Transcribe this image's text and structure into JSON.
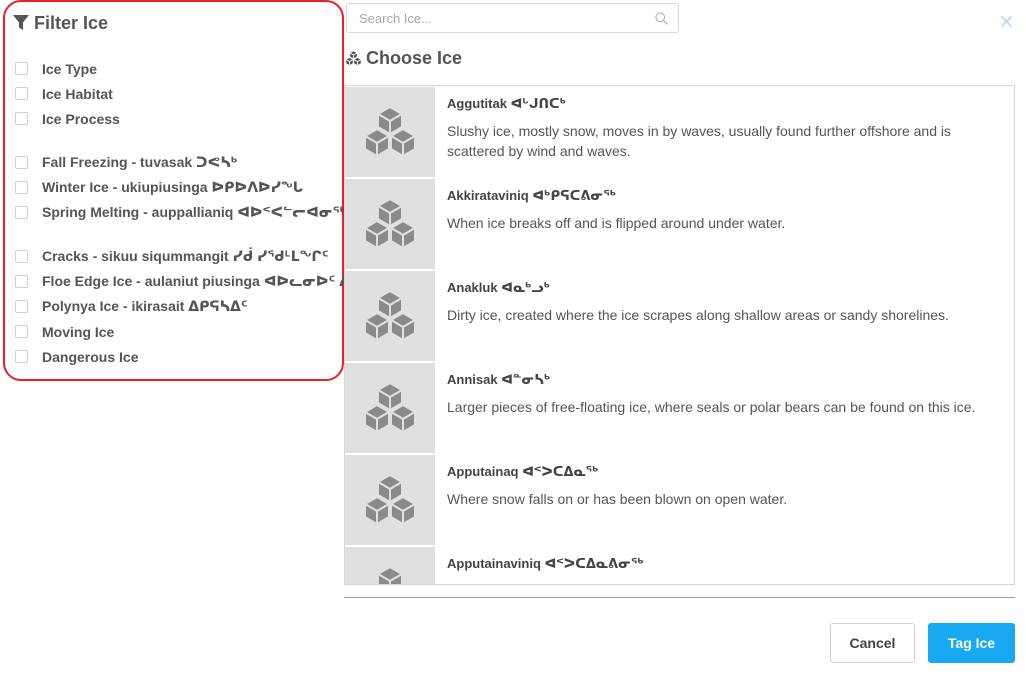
{
  "filter": {
    "title": "Filter Ice",
    "groups": [
      {
        "items": [
          {
            "label": "Ice Type",
            "checked": false
          },
          {
            "label": "Ice Habitat",
            "checked": false
          },
          {
            "label": "Ice Process",
            "checked": false
          }
        ]
      },
      {
        "items": [
          {
            "label": "Fall Freezing - tuvasak ᑐᕙᓴᒃ",
            "checked": false
          },
          {
            "label": "Winter Ice - ukiupiusinga ᐅᑭᐅᐱᐅᓯᖓ",
            "checked": false
          },
          {
            "label": "Spring Melting - auppallianiq ᐊᐅᑉᐸᓪᓕᐊᓂᖅ",
            "checked": false
          }
        ]
      },
      {
        "items": [
          {
            "label": "Cracks - sikuu siqummangit ᓯᑰ ᓯᖁᒻᒪᖏᑦ",
            "checked": false
          },
          {
            "label": "Floe Edge Ice - aulaniut piusinga ᐊᐅᓚᓂᐅᑦ ᐱᐅᓯᖓ",
            "checked": false
          },
          {
            "label": "Polynya Ice - ikirasait ᐃᑭᕋᓴᐃᑦ",
            "checked": false
          },
          {
            "label": "Moving Ice",
            "checked": false
          },
          {
            "label": "Dangerous Ice",
            "checked": false
          }
        ]
      }
    ]
  },
  "search": {
    "placeholder": "Search Ice...",
    "value": ""
  },
  "choose": {
    "title": "Choose Ice"
  },
  "ice_list": [
    {
      "name": "Aggutitak ᐊᒡᒍᑎᑕᒃ",
      "description": "Slushy ice, mostly snow, moves in by waves, usually found further offshore and is scattered by wind and waves."
    },
    {
      "name": "Akkirataviniq ᐊᒃᑭᕋᑕᕕᓂᖅ",
      "description": "When ice breaks off and is flipped around under water."
    },
    {
      "name": "Anakluk ᐊᓇᒃᓗᒃ",
      "description": "Dirty ice, created where the ice scrapes along shallow areas or sandy shorelines."
    },
    {
      "name": "Annisak ᐊᓐᓂᓴᒃ",
      "description": "Larger pieces of free-floating ice, where seals or polar bears can be found on this ice."
    },
    {
      "name": "Apputainaq ᐊᑉᐳᑕᐃᓇᖅ",
      "description": "Where snow falls on or has been blown on open water."
    },
    {
      "name": "Apputainaviniq ᐊᑉᐳᑕᐃᓇᕕᓂᖅ",
      "description": ""
    }
  ],
  "buttons": {
    "cancel": "Cancel",
    "tag": "Tag Ice"
  },
  "colors": {
    "highlight_border": "#e8202a",
    "primary": "#19a9f0",
    "thumb_bg": "#e0e0e0",
    "icon": "#8a8a8a"
  }
}
